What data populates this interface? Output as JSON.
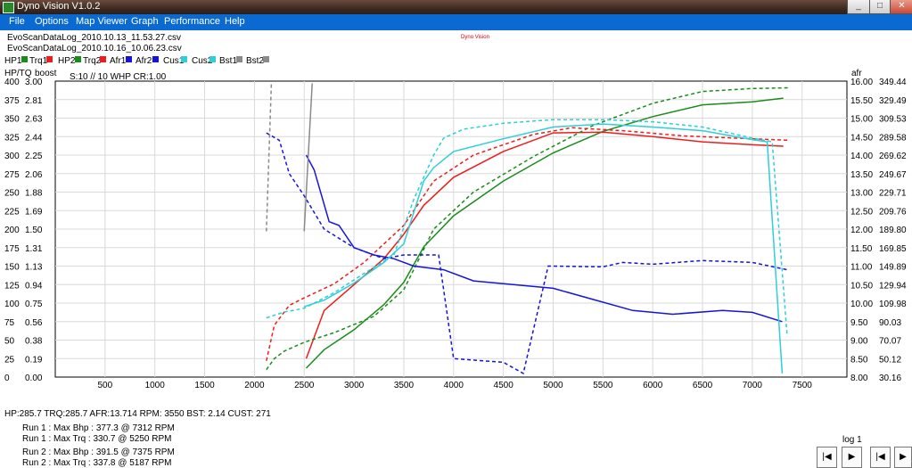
{
  "window": {
    "title": "Dyno Vision V1.0.2"
  },
  "menu": [
    "File",
    "Options",
    "Map Viewer",
    "Graph",
    "Performance",
    "Help"
  ],
  "logo_text": "Dyno Vision",
  "files": [
    "EvoScanDataLog_2010.10.13_11.53.27.csv",
    "EvoScanDataLog_2010.10.16_10.06.23.csv"
  ],
  "legend": [
    {
      "label": "HP1",
      "color": "#1a8c1a"
    },
    {
      "label": "Trq1",
      "color": "#ee1c1c"
    },
    {
      "label": "HP2",
      "color": "#1a8c1a"
    },
    {
      "label": "Trq2",
      "color": "#ee1c1c"
    },
    {
      "label": "Afr1",
      "color": "#1414dc"
    },
    {
      "label": "Afr2",
      "color": "#1414dc"
    },
    {
      "label": "Cus1",
      "color": "#2ecfd6"
    },
    {
      "label": "Cus2",
      "color": "#2ecfd6"
    },
    {
      "label": "Bst1",
      "color": "#8a8a8a"
    },
    {
      "label": "Bst2",
      "color": "#8a8a8a"
    }
  ],
  "axis": {
    "left_title": "HP/TQ",
    "boost_title": "boost",
    "right_title": "afr"
  },
  "smoothing_label": "S:10 // 10 WHP CR:1.00",
  "status_line": "HP:285.7 TRQ:285.7 AFR:13.714 RPM: 3550 BST: 2.14 CUST:  271",
  "runs": [
    "Run 1 : Max Bhp : 377.3 @ 7312 RPM",
    "Run 1 : Max Trq : 330.7 @ 5250 RPM",
    "Run 2 : Max Bhp : 391.5 @ 7375 RPM",
    "Run 2 : Max Trq : 337.8 @ 5187 RPM"
  ],
  "log_label": "log 1",
  "nav": {
    "first": "|◀",
    "play": "▶",
    "first2": "|◀",
    "play2": "▶"
  },
  "chart_data": {
    "type": "line",
    "x_ticks": [
      500,
      1000,
      1500,
      2000,
      2500,
      3000,
      3500,
      4000,
      4500,
      5000,
      5500,
      6000,
      6500,
      7000,
      7500
    ],
    "xlim": [
      0,
      7950
    ],
    "ylim": [
      0,
      400
    ],
    "hp_ticks": [
      "400",
      "375",
      "350",
      "325",
      "300",
      "275",
      "250",
      "225",
      "200",
      "175",
      "150",
      "125",
      "100",
      "75",
      "50",
      "25",
      "0"
    ],
    "boost_ticks": [
      "3.00",
      "2.81",
      "2.63",
      "2.44",
      "2.25",
      "2.06",
      "1.88",
      "1.69",
      "1.50",
      "1.31",
      "1.13",
      "0.94",
      "0.75",
      "0.56",
      "0.38",
      "0.19",
      "0.00"
    ],
    "afr_ticks": [
      "16.00",
      "15.50",
      "15.00",
      "14.50",
      "14.00",
      "13.50",
      "13.00",
      "12.50",
      "12.00",
      "11.50",
      "11.00",
      "10.50",
      "10.00",
      "9.50",
      "9.00",
      "8.50",
      "8.00"
    ],
    "cust_ticks": [
      "349.44",
      "329.49",
      "309.53",
      "289.58",
      "269.62",
      "249.67",
      "229.71",
      "209.76",
      "189.80",
      "169.85",
      "149.89",
      "129.94",
      "109.98",
      "90.03",
      "70.07",
      "50.12",
      "30.16"
    ],
    "series": [
      {
        "name": "HP1",
        "color": "#1a8c1a",
        "dash": false,
        "x": [
          2520,
          2700,
          3000,
          3300,
          3500,
          3700,
          4000,
          4500,
          5000,
          5500,
          6000,
          6500,
          7000,
          7312
        ],
        "y": [
          12,
          37,
          64,
          98,
          128,
          176,
          218,
          265,
          303,
          332,
          352,
          368,
          372,
          377
        ]
      },
      {
        "name": "Trq1",
        "color": "#ee1c1c",
        "dash": false,
        "x": [
          2520,
          2700,
          3000,
          3300,
          3500,
          3700,
          4000,
          4500,
          5000,
          5500,
          6000,
          6500,
          7000,
          7312
        ],
        "y": [
          25,
          90,
          125,
          160,
          193,
          232,
          270,
          305,
          330,
          331,
          325,
          318,
          314,
          312
        ]
      },
      {
        "name": "HP2",
        "color": "#1a8c1a",
        "dash": true,
        "x": [
          2120,
          2200,
          2300,
          2500,
          2800,
          3200,
          3500,
          3800,
          4200,
          4800,
          5400,
          6000,
          6500,
          7000,
          7375
        ],
        "y": [
          10,
          25,
          35,
          47,
          60,
          82,
          118,
          200,
          250,
          298,
          340,
          370,
          386,
          390,
          391
        ]
      },
      {
        "name": "Trq2",
        "color": "#ee1c1c",
        "dash": true,
        "x": [
          2120,
          2200,
          2350,
          2500,
          2800,
          3100,
          3500,
          3800,
          4200,
          4800,
          5187,
          5700,
          6300,
          7000,
          7375
        ],
        "y": [
          22,
          70,
          97,
          107,
          126,
          155,
          205,
          265,
          300,
          328,
          337,
          333,
          326,
          322,
          320
        ]
      },
      {
        "name": "Afr1",
        "color": "#1414dc",
        "dash": false,
        "x": [
          2520,
          2600,
          2750,
          2850,
          3000,
          3200,
          3400,
          3600,
          3900,
          4200,
          4600,
          5000,
          5400,
          5800,
          6200,
          6700,
          7000,
          7300
        ],
        "y": [
          14.0,
          13.6,
          12.2,
          12.1,
          11.5,
          11.3,
          11.2,
          11.0,
          10.9,
          10.6,
          10.5,
          10.4,
          10.1,
          9.8,
          9.7,
          9.8,
          9.75,
          9.5
        ]
      },
      {
        "name": "Afr2",
        "color": "#1414dc",
        "dash": true,
        "x": [
          2120,
          2250,
          2350,
          2500,
          2700,
          3000,
          3300,
          3500,
          3850,
          4000,
          4500,
          4700,
          4950,
          5000,
          5500,
          5700,
          6000,
          6500,
          7000,
          7350
        ],
        "y": [
          14.6,
          14.4,
          13.5,
          12.9,
          12.0,
          11.5,
          11.2,
          11.3,
          11.3,
          8.5,
          8.4,
          8.1,
          11.0,
          11.0,
          10.98,
          11.1,
          11.05,
          11.15,
          11.1,
          10.9
        ]
      },
      {
        "name": "Cus1",
        "color": "#2ecfd6",
        "dash": false,
        "x": [
          2500,
          2700,
          3000,
          3300,
          3500,
          3700,
          3800,
          4000,
          4500,
          5000,
          5500,
          6000,
          6500,
          7000,
          7150,
          7300
        ],
        "y": [
          95,
          104,
          127,
          155,
          180,
          265,
          283,
          305,
          322,
          338,
          342,
          338,
          333,
          321,
          318,
          5
        ]
      },
      {
        "name": "Cus2",
        "color": "#2ecfd6",
        "dash": true,
        "x": [
          2120,
          2300,
          2500,
          2800,
          3100,
          3400,
          3600,
          3800,
          3900,
          4100,
          4500,
          5000,
          5500,
          6000,
          6500,
          7000,
          7200,
          7350
        ],
        "y": [
          80,
          88,
          93,
          114,
          140,
          165,
          240,
          300,
          323,
          335,
          343,
          348,
          348,
          345,
          338,
          323,
          318,
          55
        ]
      },
      {
        "name": "Bst1",
        "color": "#8a8a8a",
        "dash": false,
        "x": [
          2500,
          2580
        ],
        "y": [
          197,
          397
        ]
      },
      {
        "name": "Bst2",
        "color": "#8a8a8a",
        "dash": true,
        "x": [
          2120,
          2170
        ],
        "y": [
          197,
          397
        ]
      }
    ]
  }
}
